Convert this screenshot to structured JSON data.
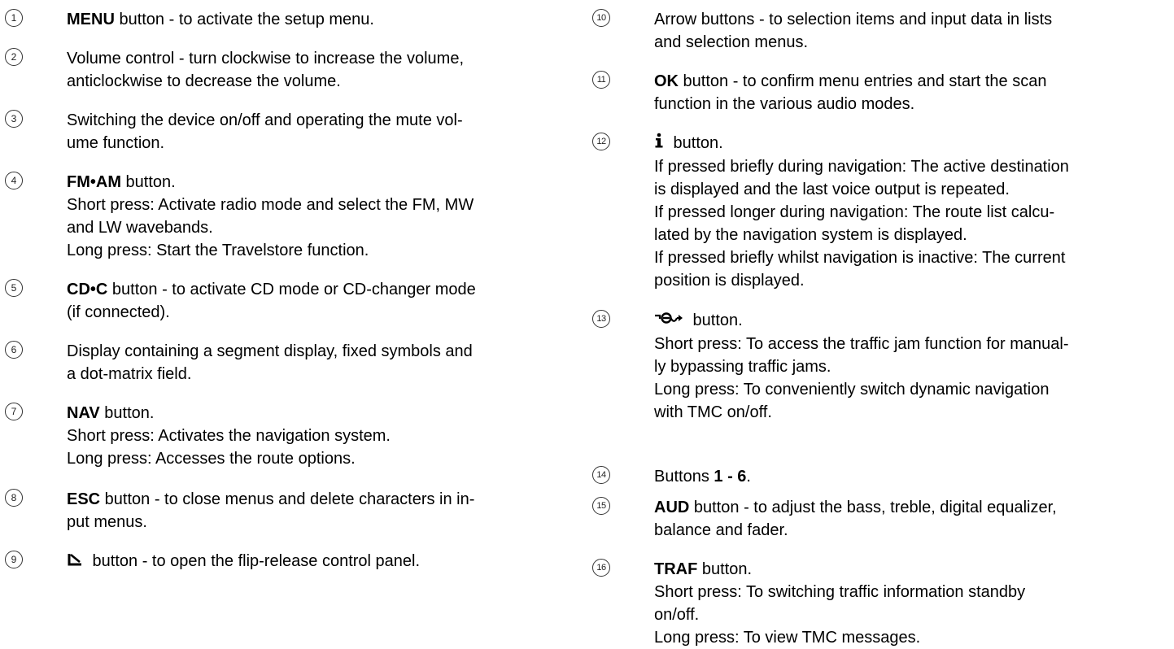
{
  "left": [
    {
      "num": "1",
      "lines": [
        {
          "bold": "MENU",
          "text": " button - to activate the setup menu."
        }
      ]
    },
    {
      "num": "2",
      "lines": [
        {
          "text": "Volume control - turn clockwise to increase the volume,"
        },
        {
          "text": "anticlockwise to decrease the volume."
        }
      ]
    },
    {
      "num": "3",
      "lines": [
        {
          "text": "Switching the device on/off and operating the mute vol-"
        },
        {
          "text": "ume function."
        }
      ]
    },
    {
      "num": "4",
      "lines": [
        {
          "bold": "FM•AM",
          "text": " button."
        },
        {
          "text": "Short press: Activate radio mode and select the FM, MW"
        },
        {
          "text": "and LW wavebands."
        },
        {
          "text": "Long press: Start the Travelstore function."
        }
      ]
    },
    {
      "num": "5",
      "lines": [
        {
          "bold": "CD•C",
          "text": " button - to activate CD mode or CD-changer mode"
        },
        {
          "text": "(if connected)."
        }
      ]
    },
    {
      "num": "6",
      "lines": [
        {
          "text": "Display containing a segment display, fixed symbols and"
        },
        {
          "text": "a dot-matrix field."
        }
      ]
    },
    {
      "num": "7",
      "lines": [
        {
          "bold": "NAV",
          "text": " button."
        },
        {
          "text": "Short press: Activates the navigation system."
        },
        {
          "text": "Long press: Accesses the route options."
        }
      ]
    },
    {
      "num": "8",
      "lines": [
        {
          "bold": "ESC",
          "text": " button - to close menus and delete characters in in-"
        },
        {
          "text": "put menus."
        }
      ]
    },
    {
      "num": "9",
      "lines": [
        {
          "icon": "flip-release-icon",
          "text": " button - to open the flip-release control panel."
        }
      ]
    }
  ],
  "right": [
    {
      "num": "10",
      "lines": [
        {
          "text": "Arrow buttons - to selection items and input data in lists"
        },
        {
          "text": "and selection menus."
        }
      ]
    },
    {
      "num": "11",
      "lines": [
        {
          "bold": "OK",
          "text": " button - to confirm menu entries and start the scan"
        },
        {
          "text": "function in the various audio modes."
        }
      ]
    },
    {
      "num": "12",
      "lines": [
        {
          "icon": "info-icon",
          "text": " button."
        },
        {
          "text": "If pressed briefly during navigation: The active destination"
        },
        {
          "text": "is displayed and the last voice output is repeated."
        },
        {
          "text": "If pressed longer during navigation: The route list calcu-"
        },
        {
          "text": "lated by the navigation system is displayed."
        },
        {
          "text": "If pressed briefly whilst navigation is inactive: The current"
        },
        {
          "text": "position is displayed."
        }
      ]
    },
    {
      "num": "13",
      "lines": [
        {
          "icon": "traffic-jam-icon",
          "text": " button."
        },
        {
          "text": "Short press: To access the traffic jam function for manual-"
        },
        {
          "text": "ly bypassing traffic jams."
        },
        {
          "text": "Long press: To conveniently switch dynamic navigation"
        },
        {
          "text": "with TMC on/off."
        }
      ]
    },
    {
      "num": "14",
      "lines": [
        {
          "text": "Buttons ",
          "bold": "1 - 6",
          "after": "."
        }
      ]
    },
    {
      "num": "15",
      "lines": [
        {
          "bold": "AUD",
          "text": " button - to adjust the bass, treble, digital equalizer,"
        },
        {
          "text": "balance and fader."
        }
      ]
    },
    {
      "num": "16",
      "lines": [
        {
          "bold": "TRAF",
          "text": " button."
        },
        {
          "text": "Short press: To switching traffic information standby"
        },
        {
          "text": "on/off."
        },
        {
          "text": "Long press: To view TMC messages."
        }
      ]
    }
  ]
}
